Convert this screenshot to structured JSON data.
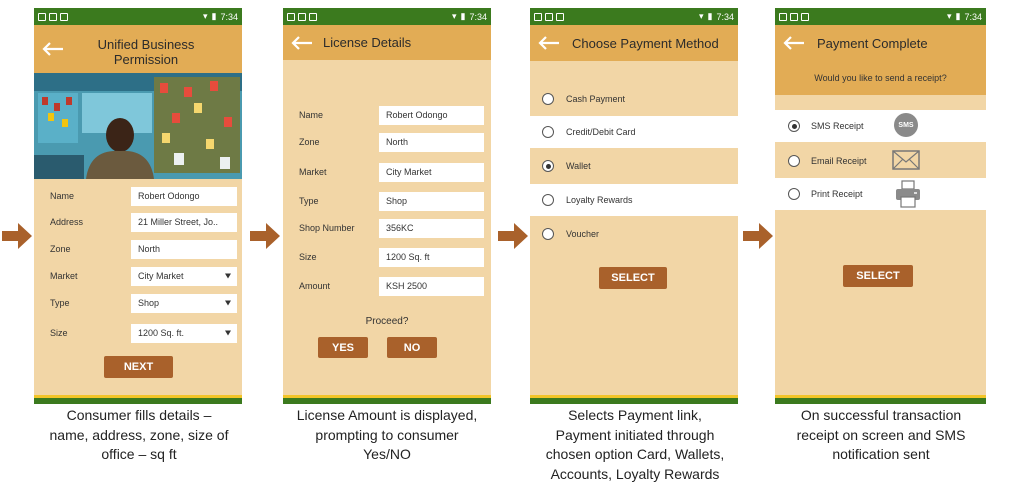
{
  "status_bar": {
    "time": "7:34"
  },
  "screens": [
    {
      "title_line1": "Unified Business",
      "title_line2": "Permission",
      "fields": [
        {
          "label": "Name",
          "value": "Robert Odongo"
        },
        {
          "label": "Address",
          "value": "21 Miller Street, Jo.."
        },
        {
          "label": "Zone",
          "value": "North"
        },
        {
          "label": "Market",
          "value": "City Market"
        },
        {
          "label": "Type",
          "value": "Shop"
        },
        {
          "label": "Size",
          "value": "1200 Sq. ft."
        }
      ],
      "next_label": "NEXT",
      "caption": [
        "Consumer fills details –",
        "name, address, zone, size of",
        "office – sq ft"
      ]
    },
    {
      "title": "License Details",
      "fields": [
        {
          "label": "Name",
          "value": "Robert Odongo"
        },
        {
          "label": "Zone",
          "value": "North"
        },
        {
          "label": "Market",
          "value": "City Market"
        },
        {
          "label": "Type",
          "value": "Shop"
        },
        {
          "label": "Shop Number",
          "value": "356KC"
        },
        {
          "label": "Size",
          "value": "1200 Sq. ft"
        },
        {
          "label": "Amount",
          "value": "KSH 2500"
        }
      ],
      "proceed": "Proceed?",
      "yes_label": "YES",
      "no_label": "NO",
      "caption": [
        "License Amount is displayed,",
        "prompting to consumer",
        "Yes/NO"
      ]
    },
    {
      "title": "Choose Payment Method",
      "options": [
        {
          "label": "Cash Payment",
          "selected": false
        },
        {
          "label": "Credit/Debit Card",
          "selected": false
        },
        {
          "label": "Wallet",
          "selected": true
        },
        {
          "label": "Loyalty Rewards",
          "selected": false
        },
        {
          "label": "Voucher",
          "selected": false
        }
      ],
      "select_label": "SELECT",
      "caption": [
        "Selects Payment link,",
        "Payment initiated through",
        "chosen option Card, Wallets,",
        "Accounts, Loyalty Rewards"
      ]
    },
    {
      "title": "Payment Complete",
      "question": "Would you like to send a receipt?",
      "options": [
        {
          "label": "SMS Receipt",
          "selected": true,
          "icon": "sms-icon"
        },
        {
          "label": "Email Receipt",
          "selected": false,
          "icon": "envelope-icon"
        },
        {
          "label": "Print Receipt",
          "selected": false,
          "icon": "printer-icon"
        }
      ],
      "sms_badge": "SMS",
      "select_label": "SELECT",
      "caption": [
        "On successful transaction",
        "receipt on screen and SMS",
        "notification sent"
      ]
    }
  ],
  "colors": {
    "status_bar": "#3b7a1e",
    "app_bar": "#e2ac55",
    "background": "#f2d6a6",
    "button": "#a9612b",
    "arrow": "#a9612b",
    "footer_stripe": "#f3c528"
  }
}
